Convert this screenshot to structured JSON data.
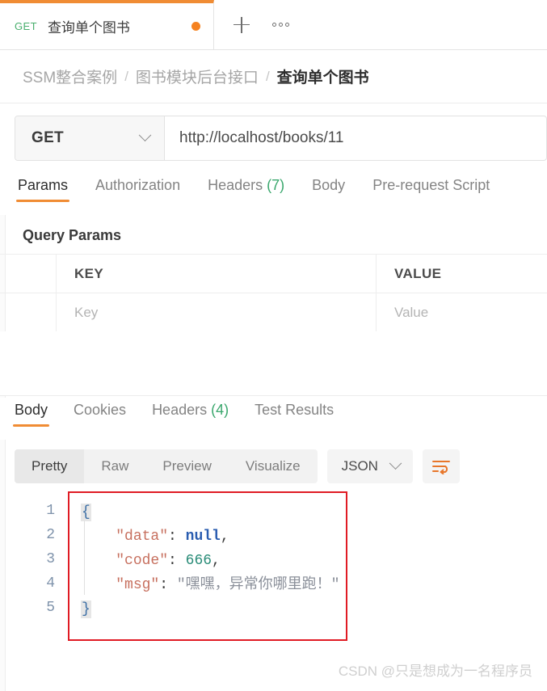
{
  "tab": {
    "method": "GET",
    "title": "查询单个图书",
    "unsaved_dot": "unsaved-dot",
    "new_tab_icon": "plus-icon",
    "more_icon": "ellipsis-icon"
  },
  "breadcrumb": {
    "items": [
      "SSM整合案例",
      "图书模块后台接口",
      "查询单个图书"
    ],
    "separator": "/"
  },
  "request": {
    "method": "GET",
    "method_chevron": "chevron-down-icon",
    "url": "http://localhost/books/11",
    "tabs": [
      {
        "label": "Params",
        "count": "",
        "active": true
      },
      {
        "label": "Authorization",
        "count": "",
        "active": false
      },
      {
        "label": "Headers",
        "count": "(7)",
        "active": false
      },
      {
        "label": "Body",
        "count": "",
        "active": false
      },
      {
        "label": "Pre-request Script",
        "count": "",
        "active": false
      }
    ]
  },
  "query_params": {
    "section_title": "Query Params",
    "columns": [
      "KEY",
      "VALUE"
    ],
    "placeholder_row": {
      "key": "Key",
      "value": "Value"
    }
  },
  "response": {
    "tabs": [
      {
        "label": "Body",
        "count": "",
        "active": true
      },
      {
        "label": "Cookies",
        "count": "",
        "active": false
      },
      {
        "label": "Headers",
        "count": "(4)",
        "active": false
      },
      {
        "label": "Test Results",
        "count": "",
        "active": false
      }
    ],
    "format_tabs": [
      {
        "label": "Pretty",
        "active": true
      },
      {
        "label": "Raw",
        "active": false
      },
      {
        "label": "Preview",
        "active": false
      },
      {
        "label": "Visualize",
        "active": false
      }
    ],
    "language": "JSON",
    "language_chevron": "chevron-down-icon",
    "wrap_icon": "wrap-text-icon",
    "line_numbers": [
      "1",
      "2",
      "3",
      "4",
      "5"
    ],
    "code": {
      "open_brace": "{",
      "close_brace": "}",
      "lines": [
        {
          "key": "\"data\"",
          "colon": ": ",
          "value": "null",
          "value_type": "null",
          "trailing": ","
        },
        {
          "key": "\"code\"",
          "colon": ": ",
          "value": "666",
          "value_type": "number",
          "trailing": ","
        },
        {
          "key": "\"msg\"",
          "colon": ": ",
          "value": "\"嘿嘿，异常你哪里跑！\"",
          "value_type": "string",
          "trailing": ""
        }
      ]
    }
  },
  "watermark": "CSDN @只是想成为一名程序员",
  "colors": {
    "accent_orange": "#f08c34",
    "method_green": "#4aaf6e",
    "count_green": "#3aa76d",
    "annotation_red": "#e01b24",
    "json_key": "#c7705f",
    "json_null": "#2a5db0",
    "json_number": "#2a8c78",
    "json_string": "#8a8f99"
  }
}
